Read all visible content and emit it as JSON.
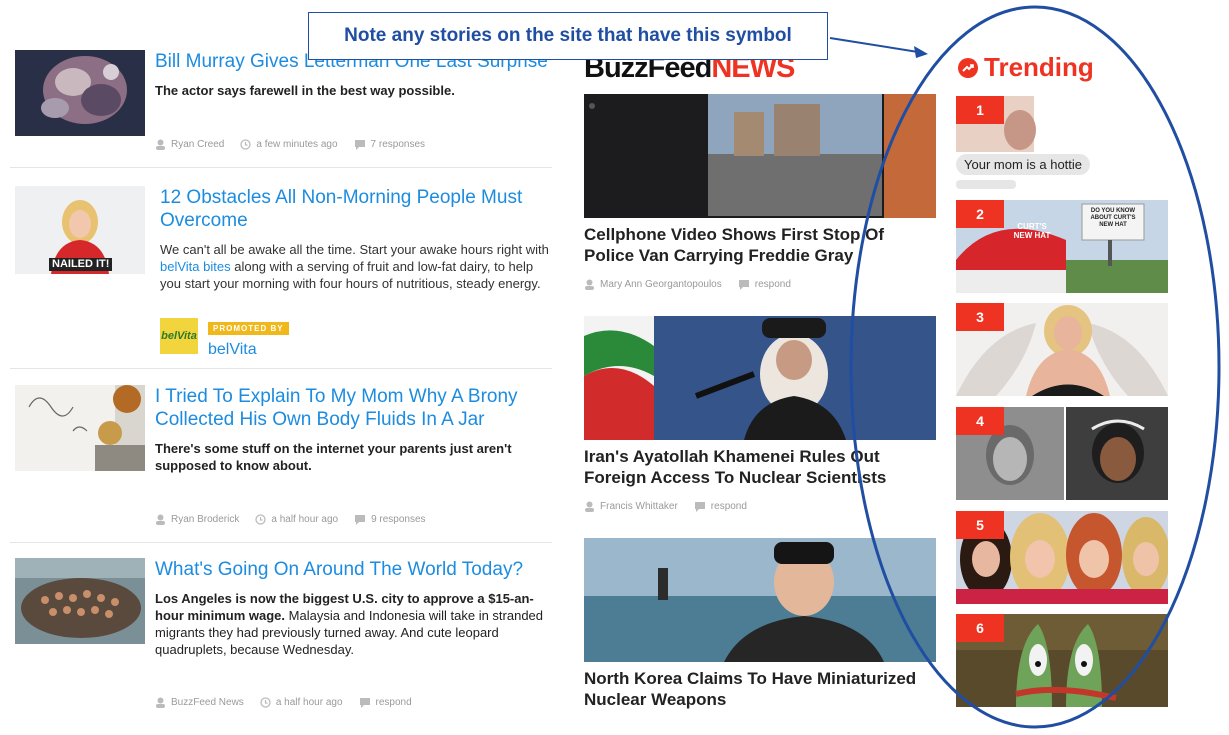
{
  "annotation": {
    "note": "Note any stories on the site that have this symbol",
    "accent": "#1f4ea2"
  },
  "feed": [
    {
      "title": "Bill Murray Gives Letterman One Last Surprise",
      "desc": "The actor says farewell in the best way possible.",
      "author": "Ryan Creed",
      "time": "a few minutes ago",
      "responses": "7 responses"
    },
    {
      "title": "12 Obstacles All Non-Morning People Must Overcome",
      "desc_part1": "We can't all be awake all the time. Start your awake hours right with",
      "desc_link": "belVita bites",
      "desc_part2": "along with a serving of fruit and low-fat dairy, to help you start your morning with four hours of nutritious, steady energy.",
      "thumb_caption": "NAILED IT!",
      "promo_badge": "PROMOTED BY",
      "promo_name": "belVita",
      "promo_logo": "belVita"
    },
    {
      "title": "I Tried To Explain To My Mom Why A Brony Collected His Own Body Fluids In A Jar",
      "desc": "There's some stuff on the internet your parents just aren't supposed to know about.",
      "author": "Ryan Broderick",
      "time": "a half hour ago",
      "responses": "9 responses"
    },
    {
      "title": "What's Going On Around The World Today?",
      "desc_bold": "Los Angeles is now the biggest U.S. city to approve a $15-an-hour minimum wage.",
      "desc_plain": "Malaysia and Indonesia will take in stranded migrants they had previously turned away. And cute leopard quadruplets, because Wednesday.",
      "author": "BuzzFeed News",
      "time": "a half hour ago",
      "responses": "respond"
    }
  ],
  "logo": {
    "part1": "BuzzFeed",
    "part2": "NEWS"
  },
  "middle": [
    {
      "title": "Cellphone Video Shows First Stop Of Police Van Carrying Freddie Gray",
      "author": "Mary Ann Georgantopoulos",
      "responses": "respond"
    },
    {
      "title": "Iran's Ayatollah Khamenei Rules Out Foreign Access To Nuclear Scientists",
      "author": "Francis Whittaker",
      "responses": "respond"
    },
    {
      "title": "North Korea Claims To Have Miniaturized Nuclear Weapons"
    }
  ],
  "trending": {
    "label": "Trending",
    "items": [
      {
        "num": "1",
        "caption": "Your mom is a hottie"
      },
      {
        "num": "2",
        "billboard": "DO YOU KNOW ABOUT CURT'S NEW HAT",
        "hat": "CURT'S NEW HAT"
      },
      {
        "num": "3"
      },
      {
        "num": "4"
      },
      {
        "num": "5"
      },
      {
        "num": "6"
      }
    ]
  },
  "colors": {
    "link_blue": "#1c8ce0",
    "trending_red": "#ee3322",
    "promo_gold": "#f0b81b"
  }
}
